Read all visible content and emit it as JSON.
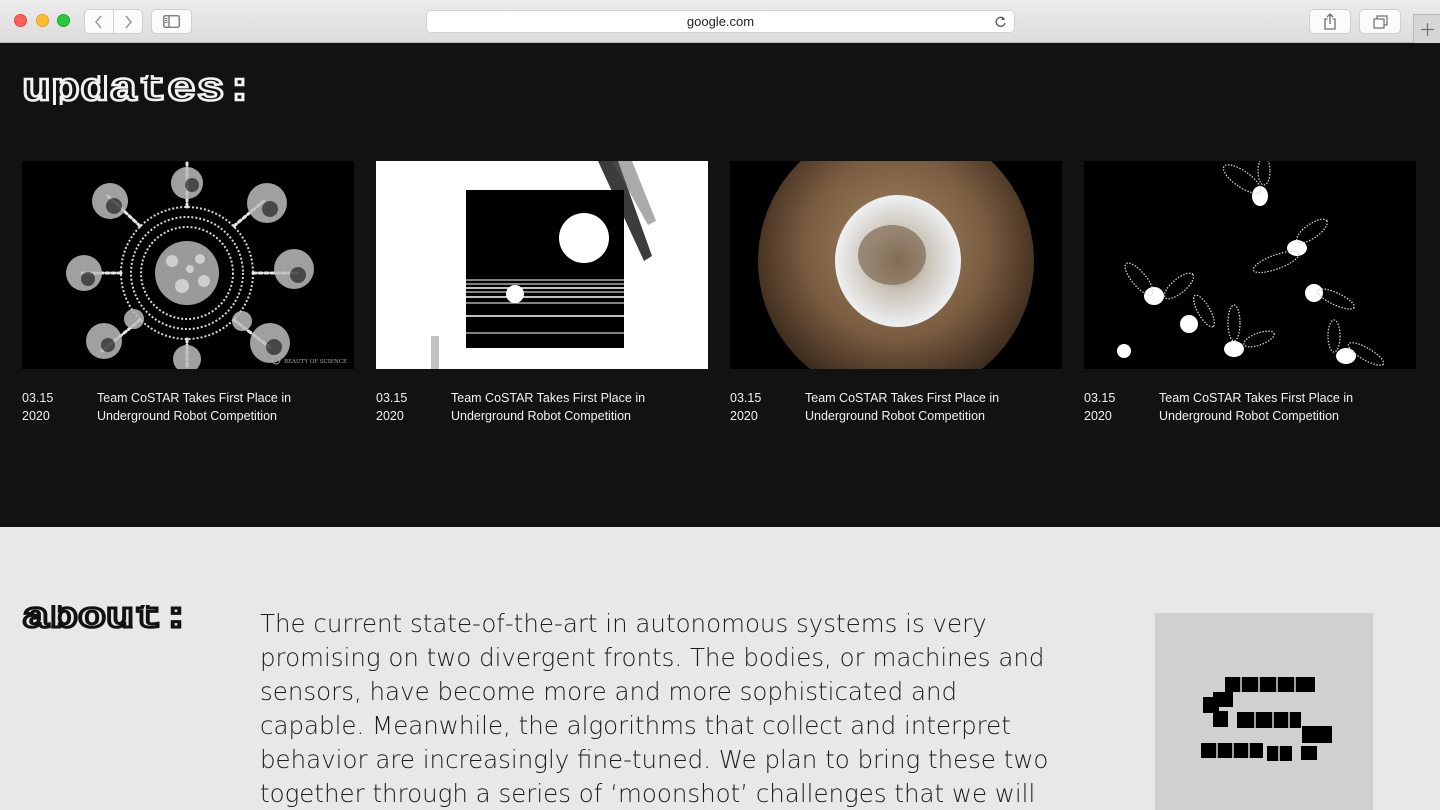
{
  "browser": {
    "address": "google.com",
    "colors": {
      "close": "#fe5f57",
      "minimize": "#febc2e",
      "maximize": "#28c840"
    },
    "icons": [
      "back-icon",
      "forward-icon",
      "sidebar-icon",
      "reload-icon",
      "share-icon",
      "tabs-icon",
      "plus-icon"
    ]
  },
  "updates": {
    "heading": "updates:",
    "cards": [
      {
        "date_line1": "03.15",
        "date_line2": "2020",
        "title": "Team CoSTAR Takes First Place in Underground Robot Competition",
        "image": "fractal-crystal",
        "watermark": "BEAUTY OF SCIENCE"
      },
      {
        "date_line1": "03.15",
        "date_line2": "2020",
        "title": "Team CoSTAR Takes First Place in Underground Robot Competition",
        "image": "sun-horizon-graphic"
      },
      {
        "date_line1": "03.15",
        "date_line2": "2020",
        "title": "Team CoSTAR Takes First Place in Underground Robot Competition",
        "image": "mars-polar-cap"
      },
      {
        "date_line1": "03.15",
        "date_line2": "2020",
        "title": "Team CoSTAR Takes First Place in Underground Robot Competition",
        "image": "flying-insects"
      }
    ],
    "colors": {
      "background": "#121212",
      "text": "#f2f2f2"
    }
  },
  "about": {
    "heading": "about:",
    "body": "The current state-of-the-art in autonomous systems is very promising on two divergent fronts. The bodies, or machines and sensors, have become more and more sophisticated and capable. Meanwhile, the algorithms that collect and interpret behavior are increasingly fine-tuned. We plan to bring these two together through a series of ‘moonshot’ challenges that we will undertake in",
    "logo": "pixel-s-logo",
    "colors": {
      "background": "#e8e8e8",
      "logo_box": "#d0d0d0"
    }
  }
}
